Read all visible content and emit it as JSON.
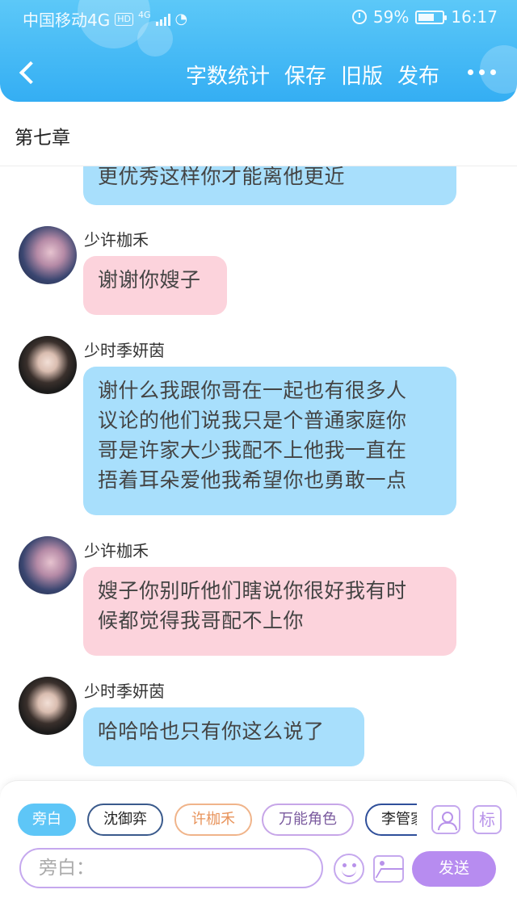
{
  "status_bar": {
    "carrier": "中国移动4G",
    "hd": "HD",
    "net": "4G",
    "battery": "59%",
    "time": "16:17"
  },
  "nav": {
    "actions": [
      "字数统计",
      "保存",
      "旧版",
      "发布"
    ]
  },
  "chapter_title": "第七章",
  "messages": [
    {
      "sender": "",
      "color": "blue",
      "text_lines": [
        "更优秀这样你才能离他更近"
      ]
    },
    {
      "sender": "少许枷禾",
      "color": "pink",
      "text_lines": [
        "谢谢你嫂子"
      ]
    },
    {
      "sender": "少时季妍茵",
      "color": "blue",
      "text_lines": [
        "谢什么我跟你哥在一起也有很多人",
        "议论的他们说我只是个普通家庭你",
        "哥是许家大少我配不上他我一直在",
        "捂着耳朵爱他我希望你也勇敢一点"
      ]
    },
    {
      "sender": "少许枷禾",
      "color": "pink",
      "text_lines": [
        "嫂子你别听他们瞎说你很好我有时",
        "候都觉得我哥配不上你"
      ]
    },
    {
      "sender": "少时季妍茵",
      "color": "blue",
      "text_lines": [
        "哈哈哈也只有你这么说了"
      ]
    }
  ],
  "roles": [
    "旁白",
    "沈御弈",
    "许枷禾",
    "万能角色",
    "李管家"
  ],
  "tag_button": "标",
  "input": {
    "placeholder": "旁白："
  },
  "send_label": "发送",
  "colors": {
    "header": "#34aef3",
    "blue_bubble": "#a8dffc",
    "pink_bubble": "#fcd3dc",
    "accent_purple": "#b78cf0"
  }
}
